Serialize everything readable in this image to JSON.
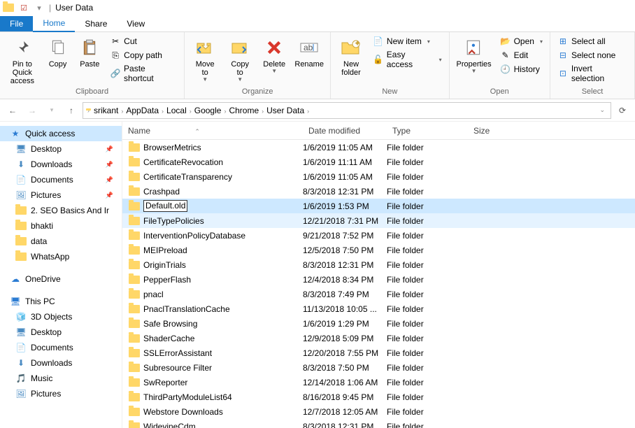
{
  "title": "User Data",
  "menu": {
    "file": "File",
    "home": "Home",
    "share": "Share",
    "view": "View"
  },
  "ribbon": {
    "pin": "Pin to Quick\naccess",
    "copy": "Copy",
    "paste": "Paste",
    "cut": "Cut",
    "copypath": "Copy path",
    "pasteshort": "Paste shortcut",
    "moveto": "Move\nto",
    "copyto": "Copy\nto",
    "delete": "Delete",
    "rename": "Rename",
    "newfolder": "New\nfolder",
    "newitem": "New item",
    "easyaccess": "Easy access",
    "properties": "Properties",
    "open": "Open",
    "edit": "Edit",
    "history": "History",
    "selectall": "Select all",
    "selectnone": "Select none",
    "invert": "Invert selection",
    "g_clipboard": "Clipboard",
    "g_organize": "Organize",
    "g_new": "New",
    "g_open": "Open",
    "g_select": "Select"
  },
  "breadcrumbs": [
    "srikant",
    "AppData",
    "Local",
    "Google",
    "Chrome",
    "User Data"
  ],
  "columns": {
    "name": "Name",
    "date": "Date modified",
    "type": "Type",
    "size": "Size"
  },
  "sidebar": {
    "quick": "Quick access",
    "pinned": [
      "Desktop",
      "Downloads",
      "Documents",
      "Pictures"
    ],
    "recent": [
      "2. SEO Basics And Ir",
      "bhakti",
      "data",
      "WhatsApp"
    ],
    "onedrive": "OneDrive",
    "thispc": "This PC",
    "pc": [
      "3D Objects",
      "Desktop",
      "Documents",
      "Downloads",
      "Music",
      "Pictures"
    ]
  },
  "rename_value": "Default.old",
  "files": [
    {
      "name": "BrowserMetrics",
      "date": "1/6/2019 11:05 AM",
      "type": "File folder"
    },
    {
      "name": "CertificateRevocation",
      "date": "1/6/2019 11:11 AM",
      "type": "File folder"
    },
    {
      "name": "CertificateTransparency",
      "date": "1/6/2019 11:05 AM",
      "type": "File folder"
    },
    {
      "name": "Crashpad",
      "date": "8/3/2018 12:31 PM",
      "type": "File folder"
    },
    {
      "name": "Default.old",
      "date": "1/6/2019 1:53 PM",
      "type": "File folder",
      "rename": true,
      "selected": true
    },
    {
      "name": "FileTypePolicies",
      "date": "12/21/2018 7:31 PM",
      "type": "File folder",
      "hover": true
    },
    {
      "name": "InterventionPolicyDatabase",
      "date": "9/21/2018 7:52 PM",
      "type": "File folder"
    },
    {
      "name": "MEIPreload",
      "date": "12/5/2018 7:50 PM",
      "type": "File folder"
    },
    {
      "name": "OriginTrials",
      "date": "8/3/2018 12:31 PM",
      "type": "File folder"
    },
    {
      "name": "PepperFlash",
      "date": "12/4/2018 8:34 PM",
      "type": "File folder"
    },
    {
      "name": "pnacl",
      "date": "8/3/2018 7:49 PM",
      "type": "File folder"
    },
    {
      "name": "PnaclTranslationCache",
      "date": "11/13/2018 10:05 ...",
      "type": "File folder"
    },
    {
      "name": "Safe Browsing",
      "date": "1/6/2019 1:29 PM",
      "type": "File folder"
    },
    {
      "name": "ShaderCache",
      "date": "12/9/2018 5:09 PM",
      "type": "File folder"
    },
    {
      "name": "SSLErrorAssistant",
      "date": "12/20/2018 7:55 PM",
      "type": "File folder"
    },
    {
      "name": "Subresource Filter",
      "date": "8/3/2018 7:50 PM",
      "type": "File folder"
    },
    {
      "name": "SwReporter",
      "date": "12/14/2018 1:06 AM",
      "type": "File folder"
    },
    {
      "name": "ThirdPartyModuleList64",
      "date": "8/16/2018 9:45 PM",
      "type": "File folder"
    },
    {
      "name": "Webstore Downloads",
      "date": "12/7/2018 12:05 AM",
      "type": "File folder"
    },
    {
      "name": "WidevineCdm",
      "date": "8/3/2018 12:31 PM",
      "type": "File folder"
    }
  ]
}
